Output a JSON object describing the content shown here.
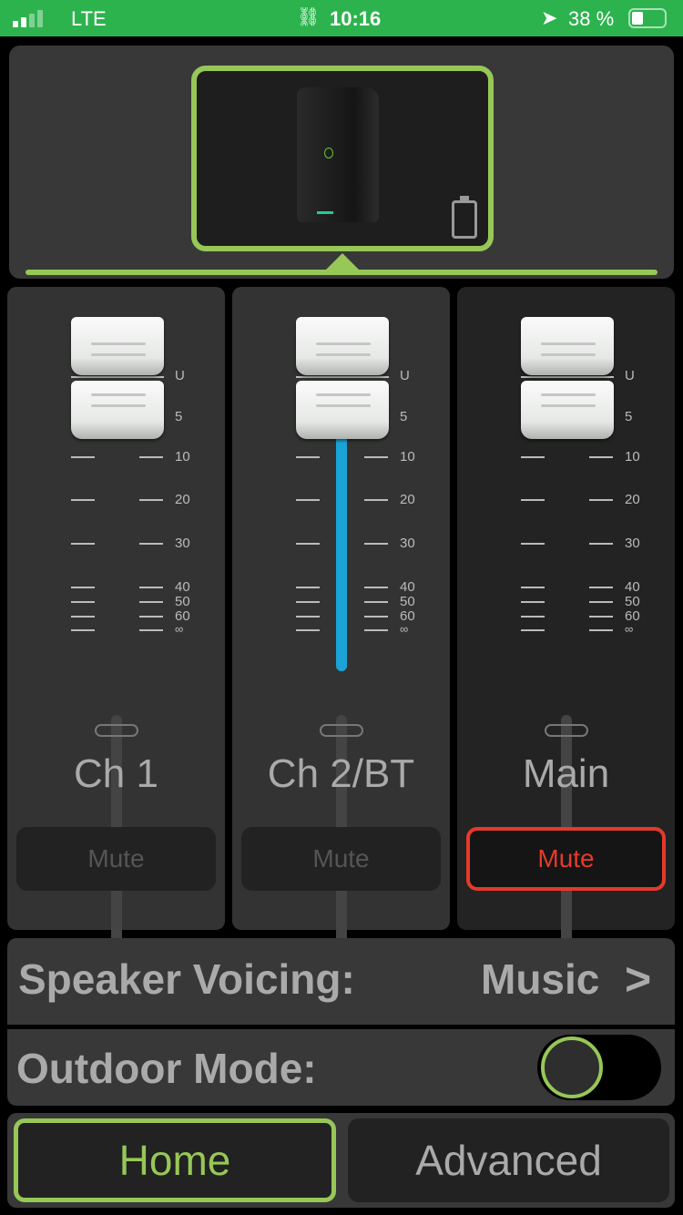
{
  "status_bar": {
    "carrier": "LTE",
    "time": "10:16",
    "battery": "38 %",
    "signal_bars": 2,
    "icons": [
      "signal-icon",
      "link-icon",
      "location-icon",
      "battery-icon"
    ]
  },
  "device": {
    "image": "speaker-image",
    "battery_icon": "battery-empty-icon"
  },
  "scale": [
    "U",
    "5",
    "10",
    "20",
    "30",
    "40",
    "50",
    "60",
    "∞"
  ],
  "channels": [
    {
      "name": "Ch 1",
      "mute": "Mute",
      "muted": false,
      "level_fraction": 0.0
    },
    {
      "name": "Ch 2/BT",
      "mute": "Mute",
      "muted": false,
      "level_fraction": 0.85
    },
    {
      "name": "Main",
      "mute": "Mute",
      "muted": true,
      "level_fraction": 0.0
    }
  ],
  "settings": {
    "voicing_label": "Speaker Voicing:",
    "voicing_value": "Music",
    "voicing_arrow": ">",
    "outdoor_label": "Outdoor Mode:",
    "outdoor_on": false
  },
  "nav": {
    "home": "Home",
    "advanced": "Advanced",
    "active": "Home"
  },
  "colors": {
    "status_green": "#2db34e",
    "accent_green": "#97c757",
    "level_blue": "#1aa3d6",
    "mute_red": "#e53a2a"
  }
}
